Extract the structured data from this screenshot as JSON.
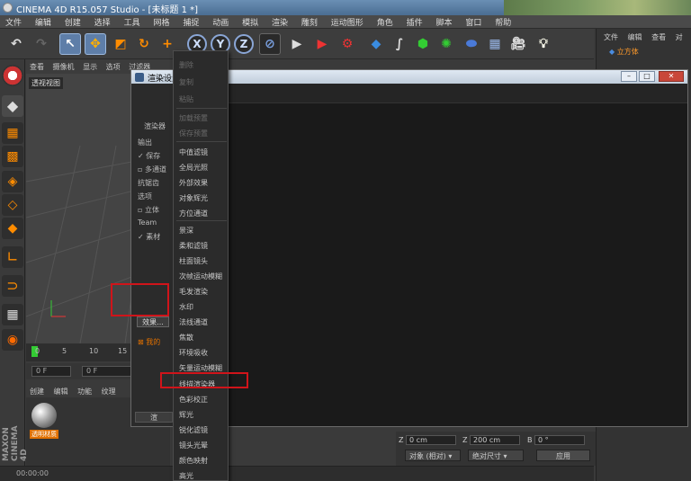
{
  "window": {
    "title": "CINEMA 4D R15.057 Studio - [未标题 1 *]"
  },
  "menubar": [
    "文件",
    "编辑",
    "创建",
    "选择",
    "工具",
    "网格",
    "捕捉",
    "动画",
    "模拟",
    "渲染",
    "雕刻",
    "运动图形",
    "角色",
    "插件",
    "脚本",
    "窗口",
    "帮助"
  ],
  "toolbar": {
    "axes": [
      "X",
      "Y",
      "Z"
    ]
  },
  "right_panel": {
    "menu": [
      "文件",
      "编辑",
      "查看",
      "对"
    ],
    "object": "立方体"
  },
  "viewport": {
    "menu": [
      "查看",
      "摄像机",
      "显示",
      "选项",
      "过滤器"
    ],
    "label": "透视视图"
  },
  "timeline": {
    "ticks": [
      "0",
      "5",
      "10",
      "15"
    ],
    "frame_start": "0 F",
    "frame_current": "0 F"
  },
  "material_panel": {
    "menu": [
      "创建",
      "编辑",
      "功能",
      "纹理"
    ],
    "material_name": "透明材质"
  },
  "brand": "MAXON CINEMA 4D",
  "status": {
    "time": "00:00:00"
  },
  "coords": {
    "z_label": "Z",
    "z_value": "0 cm",
    "z2_label": "Z",
    "z2_value": "200 cm",
    "b_label": "B",
    "b_value": "0 °",
    "mode": "对象 (相对)",
    "size_mode": "绝对尺寸",
    "apply": "应用"
  },
  "render_dialog": {
    "title": "渲染设置",
    "renderer_label": "渲染器",
    "effect_button": "效果...",
    "render_button": "渲",
    "preset_label": "我的",
    "settings": [
      "输出",
      "保存",
      "多通道",
      "抗锯齿",
      "选项",
      "立体",
      "Team",
      "素材"
    ]
  },
  "effect_menu": {
    "items": [
      {
        "label": "删除",
        "disabled": true
      },
      {
        "label": "复制",
        "disabled": true
      },
      {
        "label": "粘贴",
        "disabled": true
      },
      {
        "label": "加载预置",
        "disabled": true
      },
      {
        "label": "保存预置",
        "disabled": true
      },
      {
        "label": "中值滤镜",
        "disabled": false
      },
      {
        "label": "全局光照",
        "disabled": false
      },
      {
        "label": "外部效果",
        "disabled": false
      },
      {
        "label": "对象辉光",
        "disabled": false
      },
      {
        "label": "方位通道",
        "disabled": false
      },
      {
        "label": "景深",
        "disabled": false
      },
      {
        "label": "柔和滤镜",
        "disabled": false
      },
      {
        "label": "柱面镜头",
        "disabled": false
      },
      {
        "label": "次帧运动模糊",
        "disabled": false
      },
      {
        "label": "毛发渲染",
        "disabled": false
      },
      {
        "label": "水印",
        "disabled": false
      },
      {
        "label": "法线通道",
        "disabled": false
      },
      {
        "label": "焦散",
        "disabled": false
      },
      {
        "label": "环境吸收",
        "disabled": false
      },
      {
        "label": "矢量运动模糊",
        "disabled": false
      },
      {
        "label": "线描渲染器",
        "disabled": false
      },
      {
        "label": "色彩校正",
        "disabled": false
      },
      {
        "label": "辉光",
        "disabled": false
      },
      {
        "label": "锐化滤镜",
        "disabled": false
      },
      {
        "label": "镜头光晕",
        "disabled": false
      },
      {
        "label": "颜色映射",
        "disabled": false
      },
      {
        "label": "高光",
        "disabled": false
      }
    ]
  },
  "colors": {
    "highlight": "#d0141a",
    "selected_tool": "#5e7ea8",
    "accent_orange": "#e07000"
  }
}
